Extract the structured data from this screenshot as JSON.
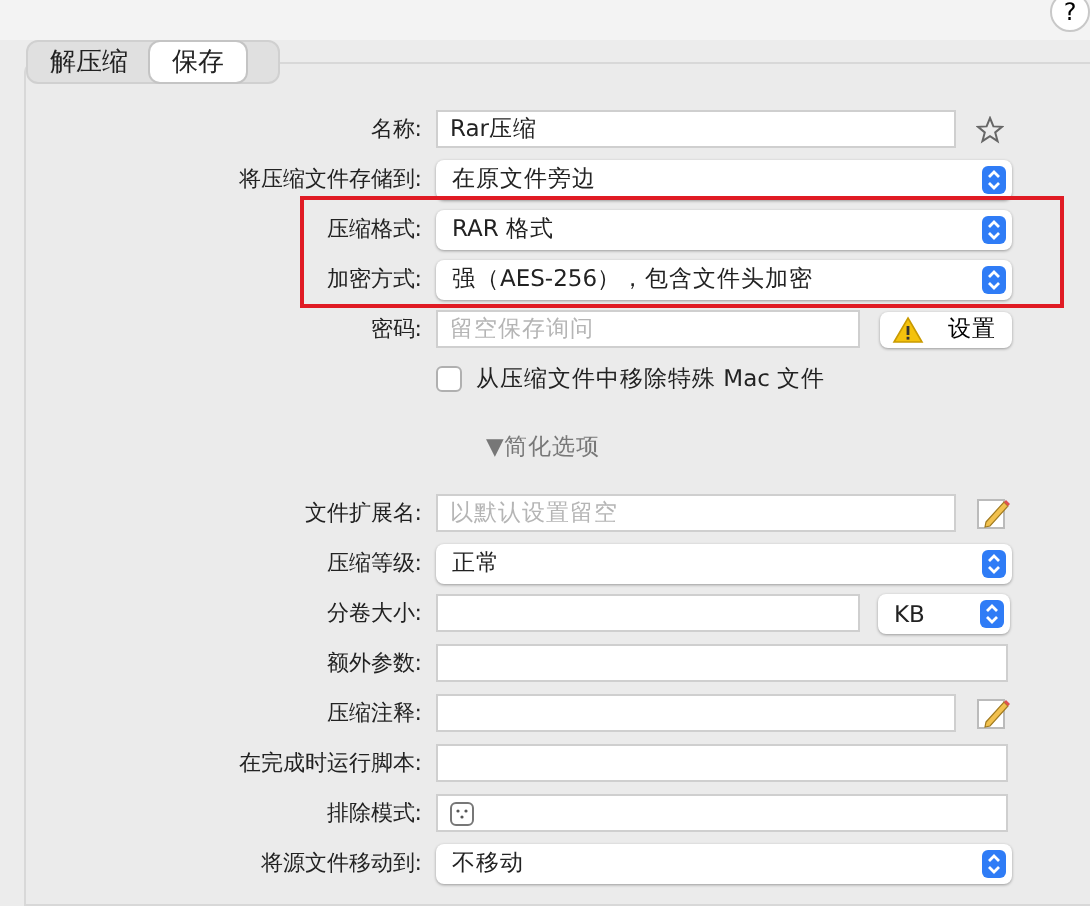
{
  "tabs": [
    {
      "label": "解压缩",
      "selected": false
    },
    {
      "label": "保存",
      "selected": true
    }
  ],
  "rows": [
    {
      "kind": "starred",
      "label": "名称:",
      "value": "Rar压缩"
    },
    {
      "kind": "select",
      "label": "将压缩文件存储到:",
      "value": "在原文件旁边"
    },
    {
      "kind": "select",
      "label": "压缩格式:",
      "value": "RAR 格式"
    },
    {
      "kind": "select",
      "label": "加密方式:",
      "value": "强（AES-256），包含文件头加密"
    },
    {
      "kind": "password",
      "label": "密码:",
      "placeholder": "留空保存询问",
      "button": "设置"
    },
    {
      "kind": "checkbox",
      "label": "从压缩文件中移除特殊 Mac 文件",
      "checked": false
    },
    {
      "kind": "disclosure",
      "label": "简化选项",
      "expanded": true,
      "marker": "▼"
    },
    {
      "kind": "editable",
      "label": "文件扩展名:",
      "placeholder": "以默认设置留空"
    },
    {
      "kind": "select",
      "label": "压缩等级:",
      "value": "正常"
    },
    {
      "kind": "size",
      "label": "分卷大小:",
      "unit": "KB"
    },
    {
      "kind": "text",
      "label": "额外参数:"
    },
    {
      "kind": "editable",
      "label": "压缩注释:"
    },
    {
      "kind": "text",
      "label": "在完成时运行脚本:"
    },
    {
      "kind": "token",
      "label": "排除模式:"
    },
    {
      "kind": "select",
      "label": "将源文件移动到:",
      "value": "不移动"
    }
  ],
  "help": "?"
}
